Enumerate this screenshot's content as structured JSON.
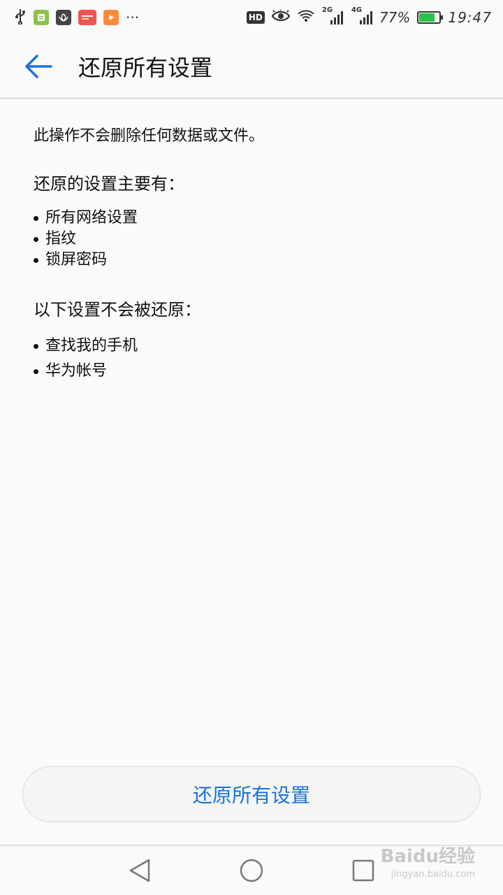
{
  "status_bar": {
    "network_1": "2G",
    "network_2": "4G",
    "battery_percent": "77%",
    "battery_level": 0.77,
    "time": "19:47",
    "hd_label": "HD",
    "more": "···",
    "icons": [
      "usb-icon",
      "app-icon-green",
      "huawei-icon",
      "app-icon-red",
      "video-icon",
      "eye-icon",
      "wifi-icon",
      "battery-icon"
    ]
  },
  "app_bar": {
    "title": "还原所有设置"
  },
  "content": {
    "intro": "此操作不会删除任何数据或文件。",
    "reset_heading": "还原的设置主要有：",
    "reset_items": [
      "所有网络设置",
      "指纹",
      "锁屏密码"
    ],
    "keep_heading": "以下设置不会被还原：",
    "keep_items": [
      "查找我的手机",
      "华为帐号"
    ]
  },
  "reset_button": {
    "label": "还原所有设置"
  },
  "watermark": {
    "main": "Baidu经验",
    "sub": "jingyan.baidu.com"
  },
  "colors": {
    "accent": "#1a73d9",
    "background": "#fafafa",
    "battery": "#29c24a"
  }
}
